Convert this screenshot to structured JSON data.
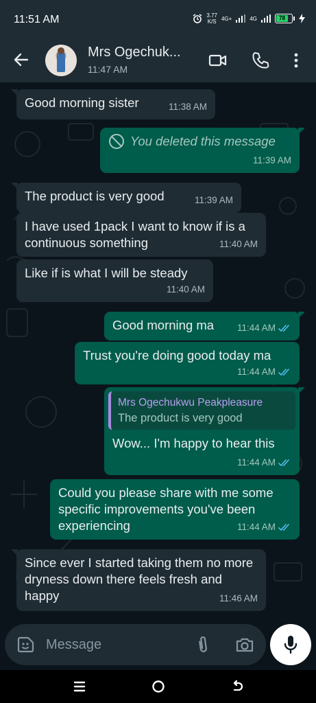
{
  "status_bar": {
    "time": "11:51 AM",
    "net_speed_value": "3.77",
    "net_speed_unit": "K/S",
    "sim1": "4G+",
    "sim2": "4G",
    "battery": "78"
  },
  "header": {
    "contact_name": "Mrs Ogechuk...",
    "last_seen": "11:47 AM"
  },
  "messages": [
    {
      "dir": "in",
      "text": "Good morning sister",
      "time": "11:38 AM"
    },
    {
      "dir": "out",
      "text": "You deleted this message",
      "time": "11:39 AM"
    },
    {
      "dir": "in",
      "text": "The product is very good",
      "time": "11:39 AM"
    },
    {
      "dir": "in",
      "text": "I have used 1pack I want to know if is a continuous something",
      "time": "11:40 AM"
    },
    {
      "dir": "in",
      "text": "Like if is what I will be steady",
      "time": "11:40 AM"
    },
    {
      "dir": "out",
      "text": "Good morning ma",
      "time": "11:44 AM"
    },
    {
      "dir": "out",
      "text": "Trust you're doing good today ma",
      "time": "11:44 AM"
    },
    {
      "dir": "out",
      "quote_name": "Mrs Ogechukwu Peakpleasure",
      "quote_text": "The product is very good",
      "text": "Wow... I'm happy to hear this",
      "time": "11:44 AM"
    },
    {
      "dir": "out",
      "text": "Could you please share with me some specific improvements you've been experiencing",
      "time": "11:44 AM"
    },
    {
      "dir": "in",
      "text": "Since ever I started taking them no more dryness down there feels fresh and happy",
      "time": "11:46 AM"
    }
  ],
  "composer": {
    "placeholder": "Message"
  },
  "colors": {
    "background": "#0b141a",
    "incoming_bubble": "#1f2c34",
    "outgoing_bubble": "#005c4b",
    "read_ticks": "#53bdeb",
    "battery_fill": "#25d366"
  },
  "icons": [
    "back-arrow-icon",
    "video-call-icon",
    "voice-call-icon",
    "more-options-icon",
    "deleted-icon",
    "read-ticks-icon",
    "emoji-sticker-icon",
    "attach-icon",
    "camera-icon",
    "mic-icon",
    "recent-apps-icon",
    "home-icon",
    "nav-back-icon"
  ]
}
